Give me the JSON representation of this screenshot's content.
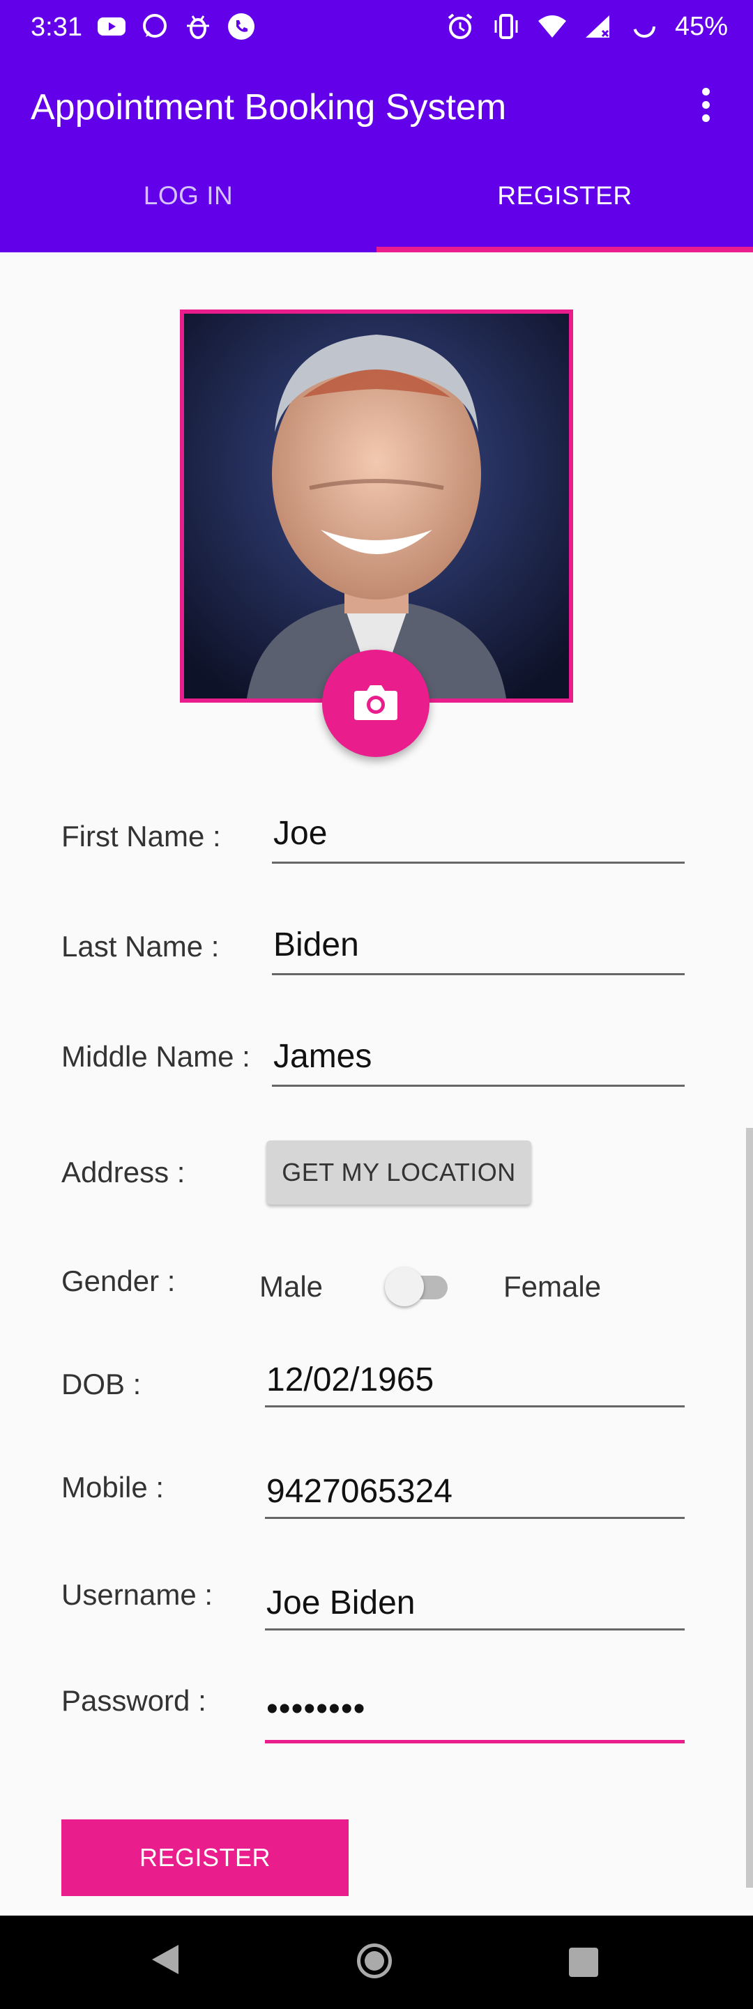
{
  "status_bar": {
    "time": "3:31",
    "battery": "45%",
    "left_icons": [
      "youtube-icon",
      "whatsapp-icon",
      "bug-icon",
      "phone-icon"
    ],
    "right_icons": [
      "alarm-icon",
      "vibrate-icon",
      "wifi-icon",
      "signal-icon",
      "battery-icon"
    ]
  },
  "app_bar": {
    "title": "Appointment Booking System",
    "menu_icon": "more-vert-icon"
  },
  "tabs": [
    {
      "label": "LOG IN",
      "selected": false
    },
    {
      "label": "REGISTER",
      "selected": true
    }
  ],
  "profile": {
    "photo": "portrait-photo",
    "camera_icon": "camera-icon"
  },
  "form": {
    "first_name": {
      "label": "First Name :",
      "value": "Joe"
    },
    "last_name": {
      "label": "Last Name :",
      "value": "Biden"
    },
    "middle_name": {
      "label": "Middle Name :",
      "value": "James"
    },
    "address": {
      "label": "Address :",
      "button": "GET MY LOCATION"
    },
    "gender": {
      "label": "Gender :",
      "male": "Male",
      "female": "Female",
      "switch_on": false
    },
    "dob": {
      "label": "DOB :",
      "value": "12/02/1965"
    },
    "mobile": {
      "label": "Mobile :",
      "value": "9427065324"
    },
    "username": {
      "label": "Username :",
      "value": "Joe Biden"
    },
    "password": {
      "label": "Password :",
      "value": "••••••••"
    },
    "submit": "REGISTER"
  },
  "colors": {
    "primary": "#6200ea",
    "accent": "#e91e8c",
    "background": "#fafafa"
  }
}
